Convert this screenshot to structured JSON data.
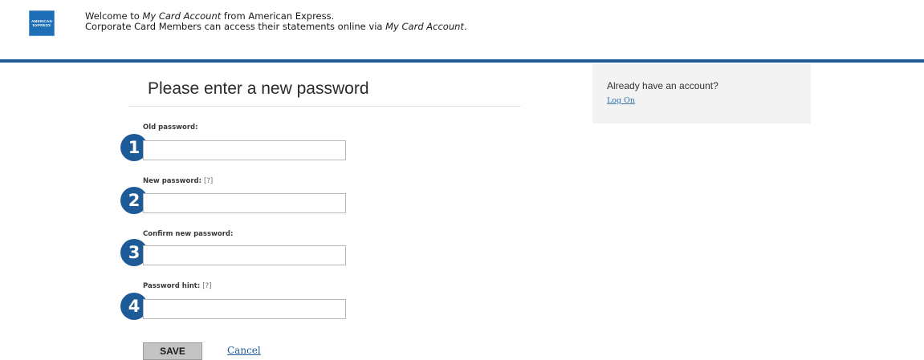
{
  "header": {
    "logo_line1": "AMERICAN",
    "logo_line2": "EXPRESS",
    "welcome_prefix": "Welcome to ",
    "welcome_product": "My Card Account",
    "welcome_suffix": " from American Express.",
    "line2_prefix": "Corporate Card Members can access their statements online via ",
    "line2_product": "My Card Account",
    "line2_suffix": ".",
    "brand_color": "#215b93"
  },
  "form": {
    "title": "Please enter a new password",
    "fields": [
      {
        "label": "Old password:",
        "help": "",
        "value": "",
        "badge": "1"
      },
      {
        "label": "New password:",
        "help": "[?]",
        "value": "",
        "badge": "2"
      },
      {
        "label": "Confirm new password:",
        "help": "",
        "value": "",
        "badge": "3"
      },
      {
        "label": "Password hint:",
        "help": "[?]",
        "value": "",
        "badge": "4"
      }
    ],
    "save_label": "SAVE",
    "cancel_label": "Cancel"
  },
  "sidebar": {
    "title": "Already have an account?",
    "link_label": "Log On"
  }
}
